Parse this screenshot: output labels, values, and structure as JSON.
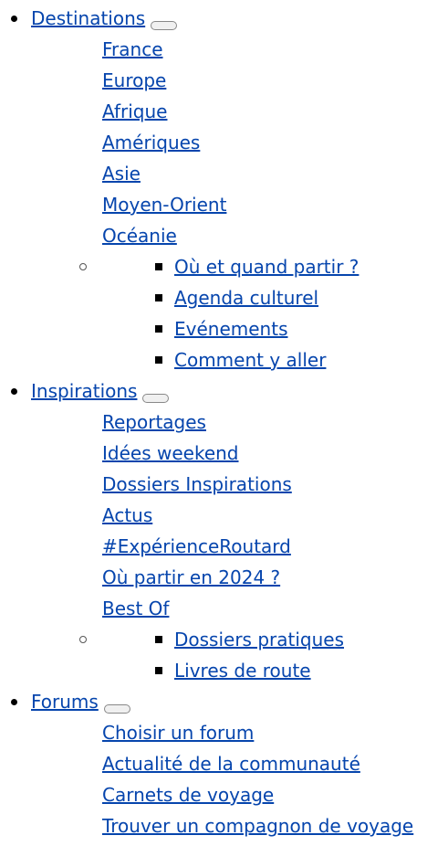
{
  "colors": {
    "link": "#0645ad"
  },
  "menu": [
    {
      "label": "Destinations",
      "items": [
        "France",
        "Europe",
        "Afrique",
        "Amériques",
        "Asie",
        "Moyen-Orient",
        "Océanie"
      ],
      "sub": [
        "Où et quand partir ?",
        "Agenda culturel",
        "Evénements",
        "Comment y aller"
      ]
    },
    {
      "label": "Inspirations",
      "items": [
        "Reportages",
        "Idées weekend",
        "Dossiers Inspirations",
        "Actus",
        "#ExpérienceRoutard",
        "Où partir en 2024 ?",
        "Best Of"
      ],
      "sub": [
        "Dossiers pratiques",
        "Livres de route"
      ]
    },
    {
      "label": "Forums",
      "items": [
        "Choisir un forum",
        "Actualité de la communauté",
        "Carnets de voyage",
        "Trouver un compagnon de voyage"
      ],
      "sub": []
    }
  ]
}
